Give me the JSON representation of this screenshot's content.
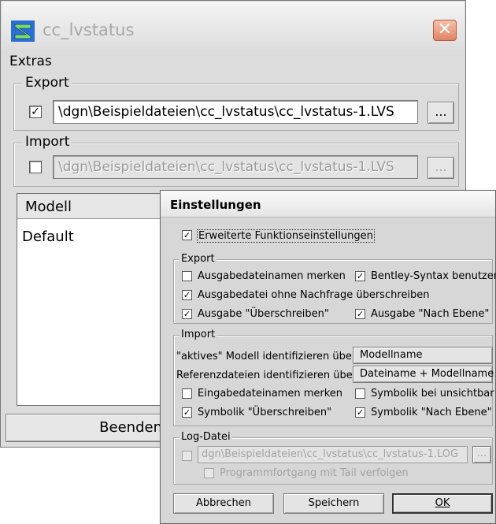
{
  "main_window": {
    "title": "cc_lvstatus",
    "close_glyph": "✕",
    "menu": [
      "Extras"
    ],
    "export": {
      "legend": "Export",
      "checked": true,
      "path": "\\dgn\\Beispieldateien\\cc_lvstatus\\cc_lvstatus-1.LVS",
      "browse_label": "..."
    },
    "import": {
      "legend": "Import",
      "checked": false,
      "path": "\\dgn\\Beispieldateien\\cc_lvstatus\\cc_lvstatus-1.LVS",
      "browse_label": "..."
    },
    "list": {
      "header": "Modell",
      "rows": [
        "Default"
      ]
    },
    "beenden_label": "Beenden"
  },
  "settings": {
    "title": "Einstellungen",
    "erweiterte": {
      "label": "Erweiterte Funktionseinstellungen",
      "checked": true
    },
    "export": {
      "legend": "Export",
      "ausgabedateinamen_merken": {
        "label": "Ausgabedateinamen merken",
        "checked": false
      },
      "bentley_syntax": {
        "label": "Bentley-Syntax benutzen",
        "checked": true
      },
      "ohne_nachfrage": {
        "label": "Ausgabedatei ohne Nachfrage überschreiben",
        "checked": true
      },
      "ausgabe_ueberschreiben": {
        "label": "Ausgabe \"Überschreiben\"",
        "checked": true
      },
      "ausgabe_nach_ebene": {
        "label": "Ausgabe \"Nach Ebene\"",
        "checked": true
      }
    },
    "import": {
      "legend": "Import",
      "aktives_label": "\"aktives\" Modell identifizieren über",
      "aktives_value": "Modellname",
      "referenz_label": "Referenzdateien identifizieren über",
      "referenz_value": "Dateiname + Modellname",
      "eingabedateinamen_merken": {
        "label": "Eingabedateinamen merken",
        "checked": false
      },
      "symbolik_unsichtbar": {
        "label": "Symbolik bei unsichtbar",
        "checked": false
      },
      "symbolik_ueberschreiben": {
        "label": "Symbolik \"Überschreiben\"",
        "checked": true
      },
      "symbolik_nach_ebene": {
        "label": "Symbolik \"Nach Ebene\"",
        "checked": true
      }
    },
    "log": {
      "legend": "Log-Datei",
      "checked": false,
      "path": "dgn\\Beispieldateien\\cc_lvstatus\\cc_lvstatus-1.LOG",
      "browse_label": "...",
      "tail": {
        "label": "Programmfortgang mit Tail verfolgen",
        "checked": false
      }
    },
    "buttons": {
      "abbrechen": "Abbrechen",
      "speichern": "Speichern",
      "ok": "OK"
    }
  }
}
